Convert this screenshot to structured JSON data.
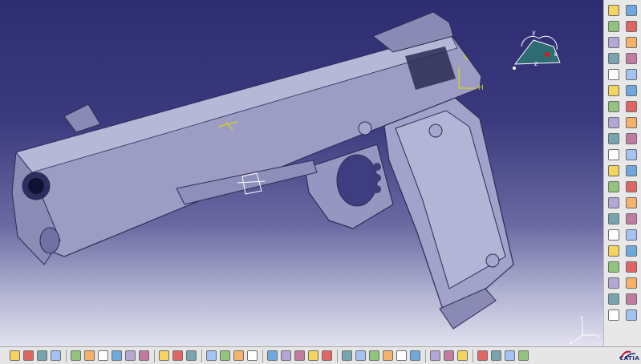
{
  "app": {
    "brand_text": "CATIA",
    "brand_color": "#1b2a7a"
  },
  "viewport": {
    "background_top": "#2e2d72",
    "background_bottom": "#e2e2ef",
    "model": "pistol-slide-and-frame-3d-model",
    "model_color": "#9c9cc4",
    "sketch_marker_color": "#d6d21a",
    "sketch_label_h": "H",
    "compass": {
      "label_x": "x",
      "label_y": "y",
      "label_z": "z"
    },
    "axis_triad": {
      "label_x": "x",
      "label_y": "y",
      "label_z": "z"
    }
  },
  "right_toolbar": {
    "icons": [
      "specifications-icon",
      "settings-icon",
      "sketcher-icon",
      "pad-icon",
      "grid-icon",
      "constraint-icon",
      "point-icon",
      "line-icon",
      "select-arrow-icon",
      "pocket-icon",
      "shaft-icon",
      "groove-icon",
      "hole-icon",
      "rib-icon",
      "slot-icon",
      "stiffener-icon",
      "fillet-icon",
      "chamfer-icon",
      "draft-icon",
      "shell-icon",
      "thickness-icon",
      "thread-icon",
      "remove-face-icon",
      "translate-icon",
      "rotate-icon",
      "symmetry-icon",
      "mirror-icon",
      "pattern-icon",
      "scale-icon",
      "split-icon",
      "thick-surface-icon",
      "close-surface-icon",
      "boolean-add-icon",
      "boolean-remove-icon",
      "intersect-icon",
      "union-trim-icon",
      "apply-material-icon",
      "measure-icon",
      "analysis-icon",
      "annotation-icon"
    ]
  },
  "bottom_toolbar": {
    "icons": [
      "new-icon",
      "open-icon",
      "save-icon",
      "print-icon",
      "cut-icon",
      "copy-icon",
      "paste-icon",
      "undo-icon",
      "redo-icon",
      "whats-this-icon",
      "formula-icon",
      "comment-icon",
      "knowledge-icon",
      "table-icon",
      "tree-icon",
      "catalog-icon",
      "parameters-icon",
      "fit-all-icon",
      "pan-icon",
      "rotate-view-icon",
      "zoom-in-icon",
      "zoom-out-icon",
      "normal-view-icon",
      "iso-view-icon",
      "shading-icon",
      "hide-show-icon",
      "swap-visible-icon",
      "render-icon",
      "measure-between-icon",
      "measure-item-icon",
      "measure-inertia-icon",
      "update-icon",
      "scan-icon",
      "cut-3d-icon",
      "swap-icon"
    ]
  }
}
